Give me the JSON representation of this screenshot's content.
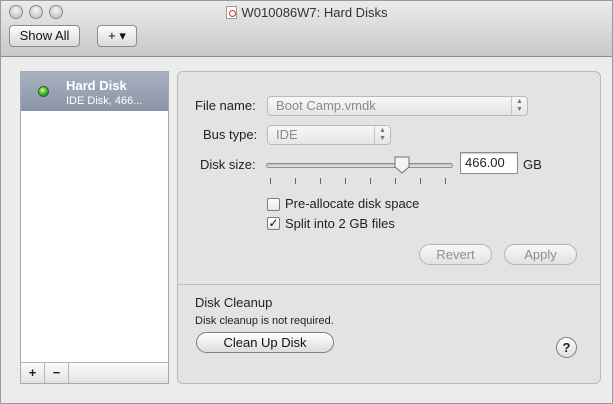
{
  "window": {
    "title": "W010086W7: Hard Disks"
  },
  "toolbar": {
    "show_all_label": "Show All",
    "add_label": "+ ▾"
  },
  "sidebar": {
    "items": [
      {
        "name": "Hard Disk",
        "description": "IDE Disk, 466...",
        "status_color": "#33a51f"
      }
    ],
    "add_label": "+",
    "remove_label": "−"
  },
  "settings": {
    "file_name_label": "File name:",
    "file_name_value": "Boot Camp.vmdk",
    "bus_type_label": "Bus type:",
    "bus_type_value": "IDE",
    "disk_size_label": "Disk size:",
    "disk_size_value": "466.00",
    "disk_size_unit": "GB",
    "preallocate_label": "Pre-allocate disk space",
    "preallocate_checked": false,
    "split_label": "Split into 2 GB files",
    "split_checked": true,
    "revert_label": "Revert",
    "apply_label": "Apply"
  },
  "cleanup": {
    "heading": "Disk Cleanup",
    "status": "Disk cleanup is not required.",
    "button_label": "Clean Up Disk",
    "help_label": "?"
  }
}
